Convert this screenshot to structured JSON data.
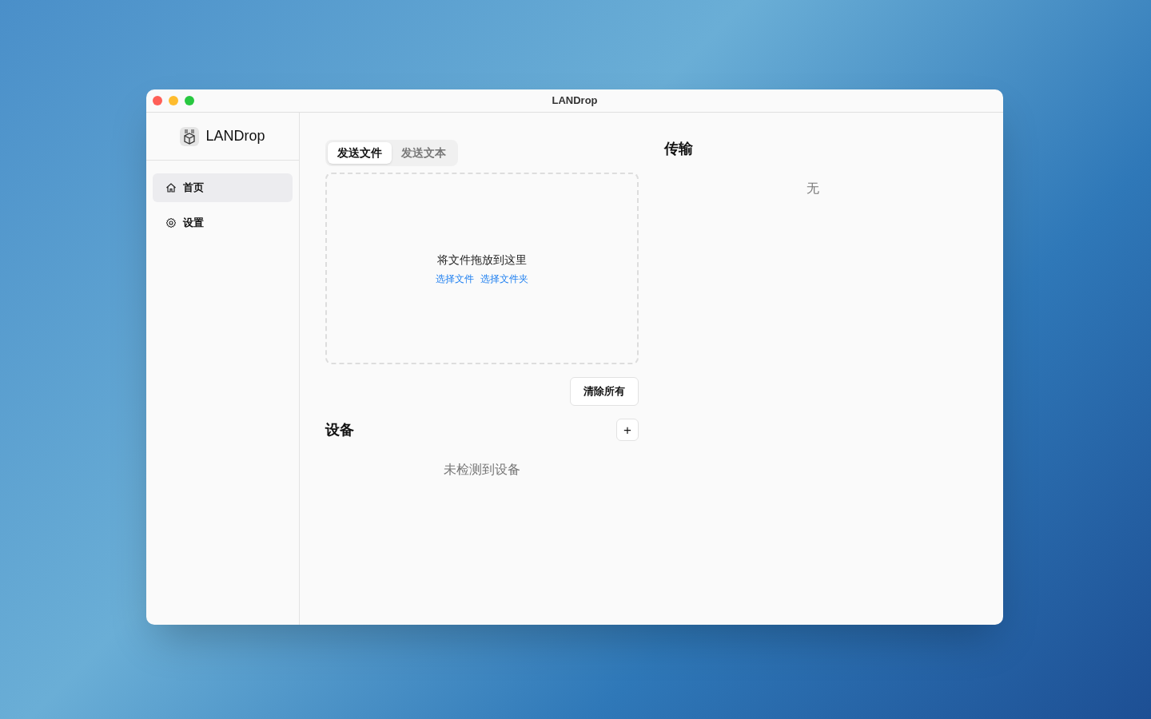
{
  "window": {
    "title": "LANDrop"
  },
  "sidebar": {
    "app_name": "LANDrop",
    "items": [
      {
        "label": "首页",
        "kind": "home",
        "selected": true
      },
      {
        "label": "设置",
        "kind": "settings",
        "selected": false
      }
    ]
  },
  "tabs": [
    {
      "label": "发送文件",
      "selected": true
    },
    {
      "label": "发送文本",
      "selected": false
    }
  ],
  "drop_zone": {
    "text": "将文件拖放到这里",
    "links": [
      "选择文件",
      "选择文件夹"
    ]
  },
  "clear_button": "清除所有",
  "devices": {
    "title": "设备",
    "add_button": "+",
    "empty": "未检测到设备"
  },
  "transfers": {
    "title": "传输",
    "empty": "无"
  }
}
